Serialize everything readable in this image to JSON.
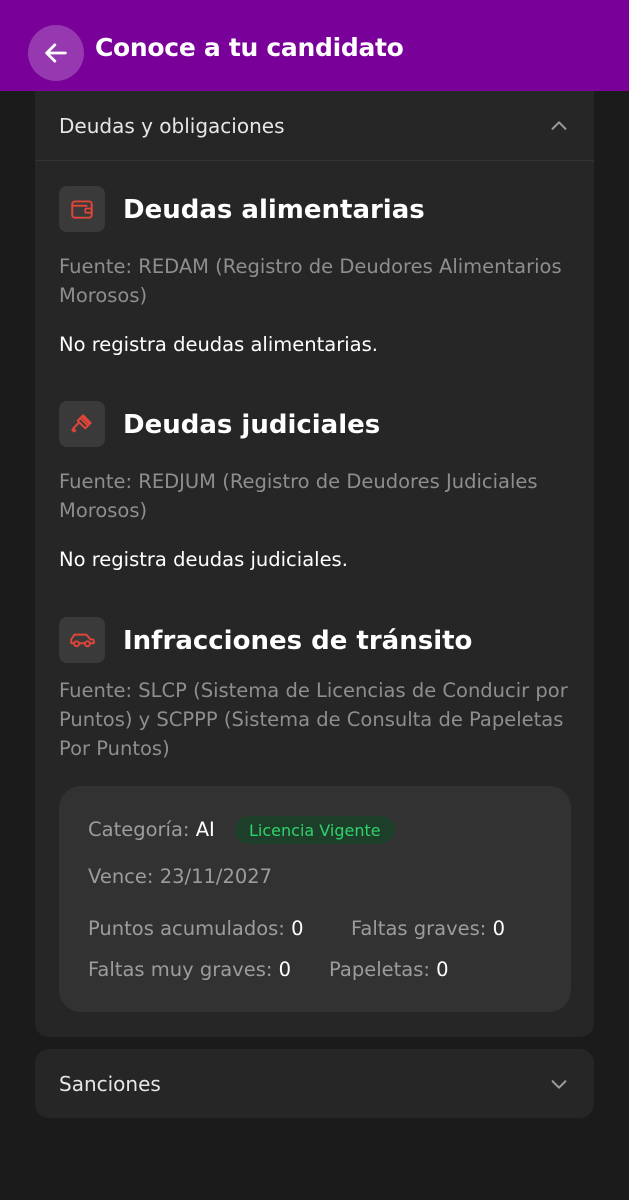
{
  "header": {
    "title": "Conoce a tu candidato",
    "back_icon": "arrow-left-icon"
  },
  "colors": {
    "appbar": "#790099",
    "accent_red": "#e0453a",
    "badge_green": "#2fd36b"
  },
  "debts_card": {
    "label": "Deudas y obligaciones",
    "expanded": true,
    "sections": [
      {
        "icon": "wallet-icon",
        "title": "Deudas alimentarias",
        "source": "Fuente: REDAM (Registro de Deudores Alimentarios Morosos)",
        "result": "No registra deudas alimentarias."
      },
      {
        "icon": "gavel-icon",
        "title": "Deudas judiciales",
        "source": "Fuente: REDJUM (Registro de Deudores Judiciales Morosos)",
        "result": "No registra deudas judiciales."
      },
      {
        "icon": "car-icon",
        "title": "Infracciones de tránsito",
        "source": "Fuente: SLCP (Sistema de Licencias de Conducir por Puntos) y SCPPP (Sistema de Consulta de Papeletas Por Puntos)"
      }
    ],
    "license": {
      "category_label": "Categoría:",
      "category_value": "AI",
      "status_badge": "Licencia Vigente",
      "expires_label": "Vence:",
      "expires_value": "23/11/2027",
      "points_label": "Puntos acumulados:",
      "points_value": "0",
      "serious_label": "Faltas graves:",
      "serious_value": "0",
      "very_serious_label": "Faltas muy graves:",
      "very_serious_value": "0",
      "tickets_label": "Papeletas:",
      "tickets_value": "0"
    }
  },
  "sanctions_card": {
    "label": "Sanciones",
    "expanded": false
  }
}
